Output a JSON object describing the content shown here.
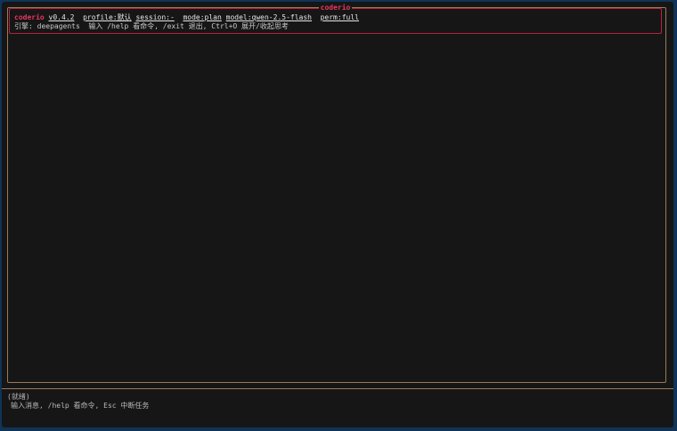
{
  "header": {
    "title": "coderio",
    "app_name": "coderio",
    "version": "v0.4.2",
    "profile": "profile:默认",
    "session": "session:-",
    "mode": "mode:plan",
    "model": "model:qwen-2.5-flash",
    "perm": "perm:full",
    "engine_line": "引擎: deepagents  输入 /help 看命令, /exit 退出, Ctrl+O 展开/收起思考"
  },
  "footer": {
    "status": "(就绪)",
    "input_placeholder": "输入消息, /help 看命令, Esc 中断任务"
  },
  "colors": {
    "accent": "#e8365e",
    "frame": "#9a7a58",
    "background": "#161616",
    "window": "#0f3457"
  }
}
